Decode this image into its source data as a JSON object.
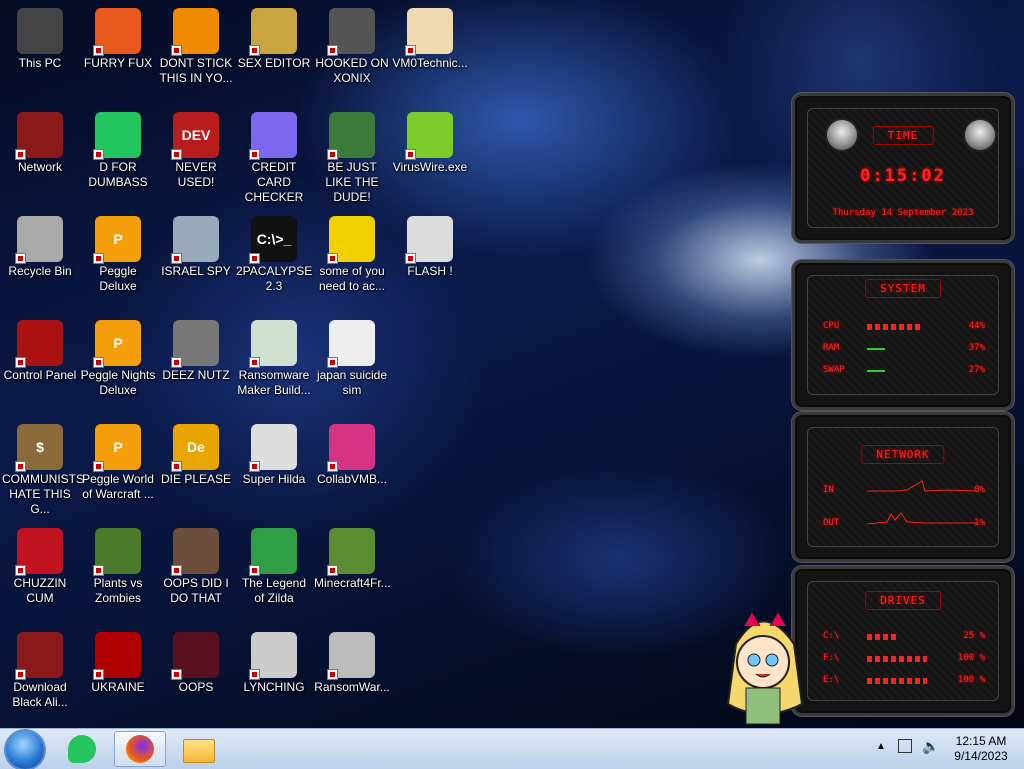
{
  "desktop": {
    "icons": [
      {
        "label": "This PC",
        "color": "#444"
      },
      {
        "label": "FURRY FUX",
        "color": "#e8571c"
      },
      {
        "label": "DONT STICK THIS IN YO...",
        "color": "#f08a00"
      },
      {
        "label": "SEX EDITOR",
        "color": "#c9a441"
      },
      {
        "label": "HOOKED ON XONIX",
        "color": "#555"
      },
      {
        "label": "VM0Technic...",
        "color": "#f0d8b0"
      },
      {
        "label": "Network",
        "color": "#8a1a1a"
      },
      {
        "label": "D FOR DUMBASS",
        "color": "#22c55e"
      },
      {
        "label": "NEVER USED!",
        "color": "#b91c1c",
        "text": "DEV"
      },
      {
        "label": "CREDIT CARD CHECKER",
        "color": "#7b68ee"
      },
      {
        "label": "BE JUST LIKE THE DUDE!",
        "color": "#3b7a3b"
      },
      {
        "label": "VirusWire.exe",
        "color": "#7ccc2a"
      },
      {
        "label": "Recycle Bin",
        "color": "#aaa"
      },
      {
        "label": "Peggle Deluxe",
        "color": "#f59e0b",
        "text": "P"
      },
      {
        "label": "ISRAEL SPY",
        "color": "#9ab"
      },
      {
        "label": "2PACALYPSE 2.3",
        "color": "#111",
        "text": "C:\\>_"
      },
      {
        "label": "some of you need to ac...",
        "color": "#f2d000"
      },
      {
        "label": "FLASH !",
        "color": "#ddd"
      },
      {
        "label": "Control Panel",
        "color": "#a11"
      },
      {
        "label": "Peggle Nights Deluxe",
        "color": "#f59e0b",
        "text": "P"
      },
      {
        "label": "DEEZ NUTZ",
        "color": "#777"
      },
      {
        "label": "Ransomware Maker Build...",
        "color": "#cfe0d0"
      },
      {
        "label": "japan suicide sim",
        "color": "#eee"
      },
      {
        "label": "",
        "color": "transparent"
      },
      {
        "label": "COMMUNISTS HATE THIS G...",
        "color": "#8b6a3a",
        "text": "$"
      },
      {
        "label": "Peggle World of Warcraft ...",
        "color": "#f59e0b",
        "text": "P"
      },
      {
        "label": "DIE PLEASE",
        "color": "#e8a400",
        "text": "De"
      },
      {
        "label": "Super Hilda",
        "color": "#ddd"
      },
      {
        "label": "CollabVMB...",
        "color": "#d63384"
      },
      {
        "label": "",
        "color": "transparent"
      },
      {
        "label": "CHUZZIN CUM",
        "color": "#c1121f"
      },
      {
        "label": "Plants vs Zombies",
        "color": "#4a7a2a"
      },
      {
        "label": "OOPS DID I DO THAT",
        "color": "#6b4f3a"
      },
      {
        "label": "The Legend of Zilda",
        "color": "#2f9e44"
      },
      {
        "label": "Minecraft4Fr...",
        "color": "#5b8c32"
      },
      {
        "label": "",
        "color": "transparent"
      },
      {
        "label": "Download Black Ali...",
        "color": "#8a1a1a"
      },
      {
        "label": "UKRAINE",
        "color": "#b00000"
      },
      {
        "label": "OOPS",
        "color": "#5a1020"
      },
      {
        "label": "LYNCHING",
        "color": "#ccc"
      },
      {
        "label": "RansomWar...",
        "color": "#bbb"
      }
    ]
  },
  "gadget": {
    "time": {
      "title": "TIME",
      "clock": "0:15:02",
      "date": "Thursday 14 September 2023"
    },
    "system": {
      "title": "SYSTEM",
      "rows": [
        {
          "name": "CPU",
          "value": "44%",
          "level": 0.44
        },
        {
          "name": "RAM",
          "value": "37%",
          "level": 0.05
        },
        {
          "name": "SWAP",
          "value": "27%",
          "level": 0.05
        }
      ]
    },
    "network": {
      "title": "NETWORK",
      "rows": [
        {
          "name": "IN",
          "value": "0%"
        },
        {
          "name": "OUT",
          "value": "1%"
        }
      ]
    },
    "drives": {
      "title": "DRIVES",
      "rows": [
        {
          "name": "C:\\",
          "value": "25 %",
          "level": 0.25
        },
        {
          "name": "F:\\",
          "value": "100 %",
          "level": 1.0
        },
        {
          "name": "E:\\",
          "value": "100 %",
          "level": 1.0
        }
      ]
    }
  },
  "taskbar": {
    "time": "12:15 AM",
    "date": "9/14/2023"
  }
}
